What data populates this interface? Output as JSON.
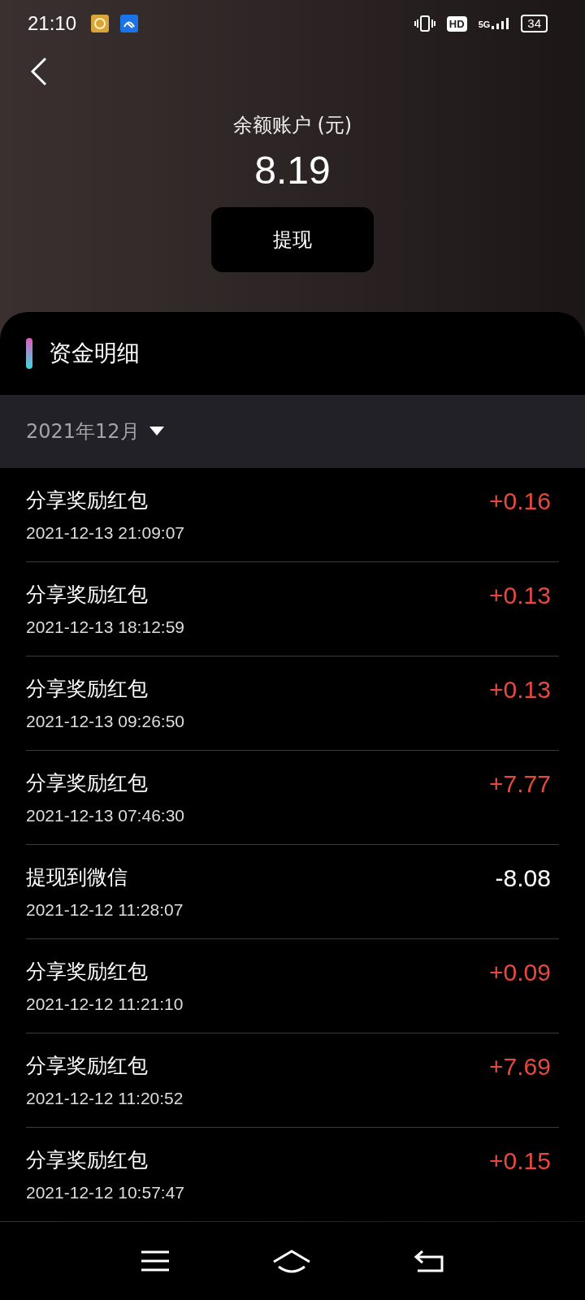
{
  "status_bar": {
    "time": "21:10",
    "hd": "HD",
    "network": "5G",
    "battery": "34"
  },
  "header": {
    "title": "余额账户 (元)",
    "balance": "8.19",
    "withdraw_button": "提现"
  },
  "section": {
    "title": "资金明细",
    "month": "2021年12月"
  },
  "transactions": [
    {
      "title": "分享奖励红包",
      "time": "2021-12-13 21:09:07",
      "amount": "+0.16",
      "kind": "income"
    },
    {
      "title": "分享奖励红包",
      "time": "2021-12-13 18:12:59",
      "amount": "+0.13",
      "kind": "income"
    },
    {
      "title": "分享奖励红包",
      "time": "2021-12-13 09:26:50",
      "amount": "+0.13",
      "kind": "income"
    },
    {
      "title": "分享奖励红包",
      "time": "2021-12-13 07:46:30",
      "amount": "+7.77",
      "kind": "income"
    },
    {
      "title": "提现到微信",
      "time": "2021-12-12 11:28:07",
      "amount": "-8.08",
      "kind": "withdrawal"
    },
    {
      "title": "分享奖励红包",
      "time": "2021-12-12 11:21:10",
      "amount": "+0.09",
      "kind": "income"
    },
    {
      "title": "分享奖励红包",
      "time": "2021-12-12 11:20:52",
      "amount": "+7.69",
      "kind": "income"
    },
    {
      "title": "分享奖励红包",
      "time": "2021-12-12 10:57:47",
      "amount": "+0.15",
      "kind": "income"
    }
  ]
}
